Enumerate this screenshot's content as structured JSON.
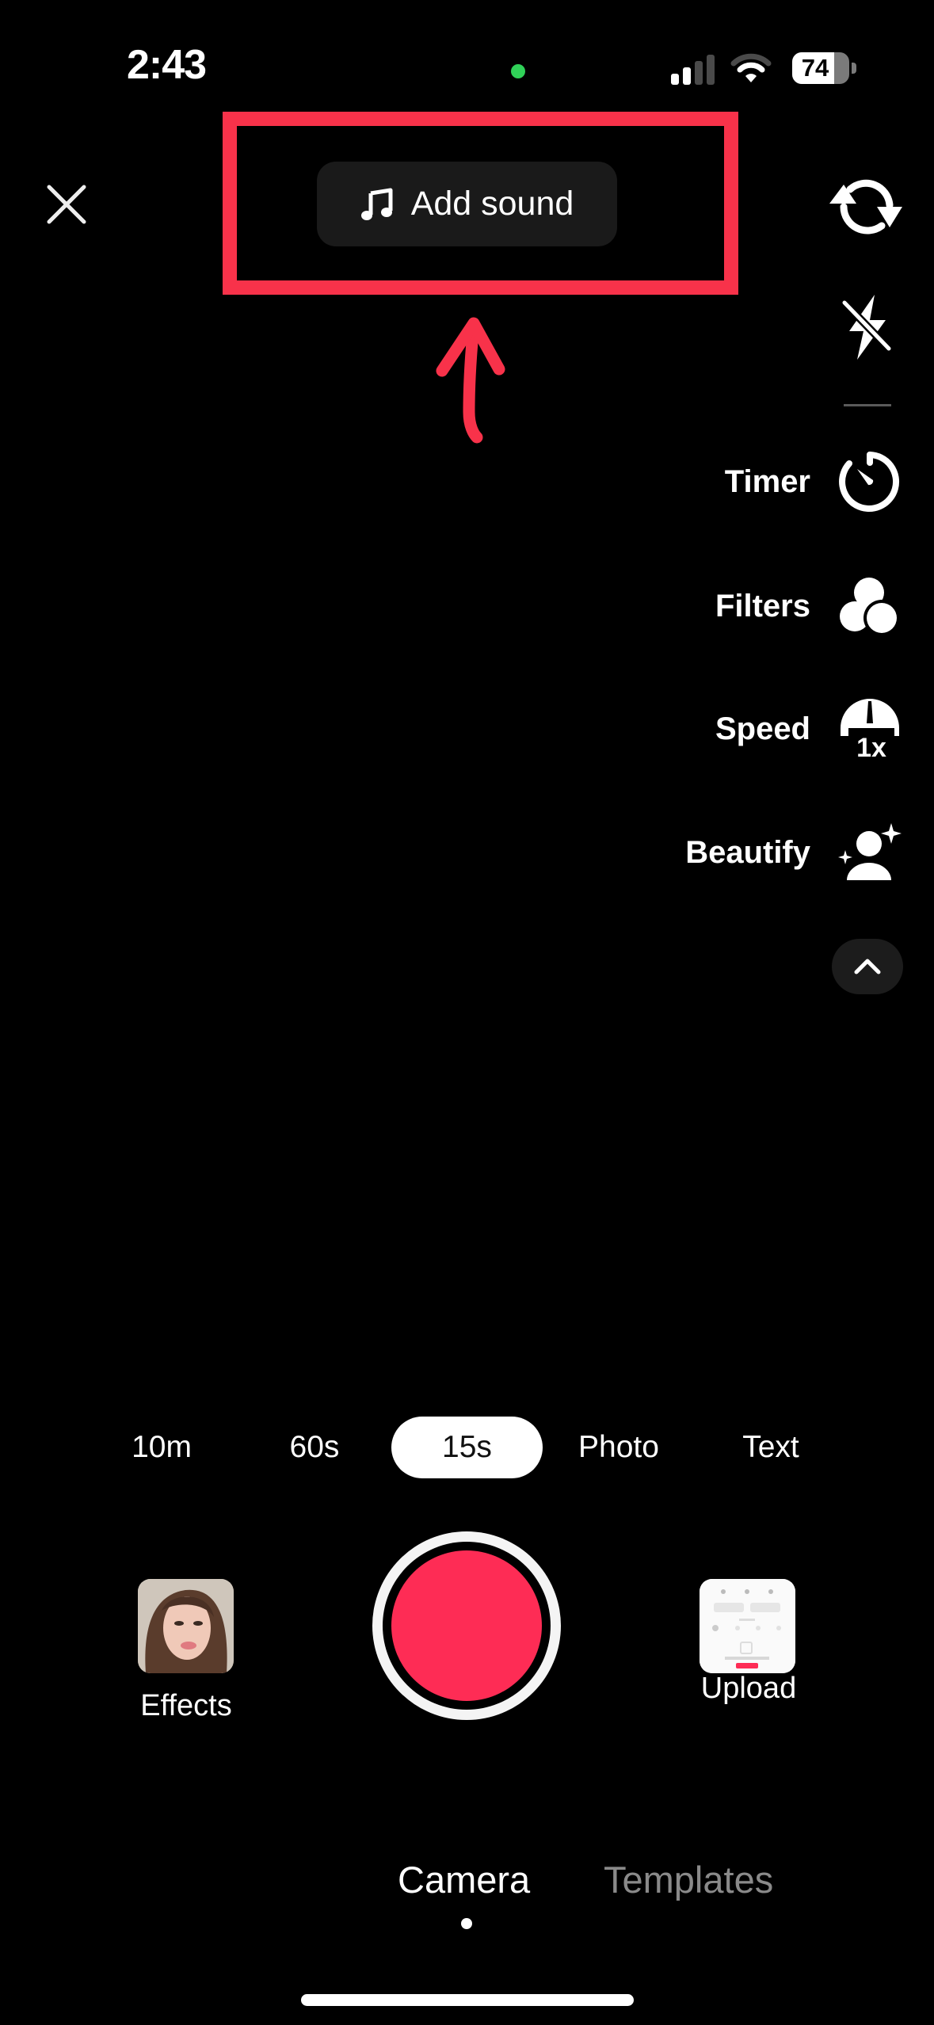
{
  "status_bar": {
    "time": "2:43",
    "privacy_indicator_color": "#30d158",
    "signal_bars_active": 2,
    "signal_bars_total": 4,
    "wifi_arcs_active": 2,
    "wifi_arcs_total": 3,
    "battery_percent": 74,
    "battery_label": "74"
  },
  "top": {
    "close_icon": "close-icon",
    "add_sound_label": "Add sound",
    "add_sound_icon": "music-note-icon",
    "flip_icon": "flip-camera-icon",
    "flash_icon": "flash-off-icon"
  },
  "annotation": {
    "color": "#f8324a",
    "shape": "rectangle-with-arrow"
  },
  "side_tools": [
    {
      "label": "Timer",
      "icon": "timer-icon"
    },
    {
      "label": "Filters",
      "icon": "filters-icon"
    },
    {
      "label": "Speed",
      "icon": "speed-icon",
      "badge": "1x"
    },
    {
      "label": "Beautify",
      "icon": "beautify-icon"
    }
  ],
  "collapse_icon": "chevron-up-icon",
  "modes": {
    "items": [
      "10m",
      "60s",
      "15s",
      "Photo",
      "Text"
    ],
    "selected": "15s"
  },
  "bottom": {
    "effects_label": "Effects",
    "upload_label": "Upload",
    "record_color": "#fe2c55"
  },
  "tabs": {
    "items": [
      {
        "label": "Camera",
        "active": true
      },
      {
        "label": "Templates",
        "active": false
      }
    ]
  },
  "colors": {
    "accent": "#fe2c55",
    "inactive_tab": "#8a8a8a",
    "pill_bg": "#1a1a1a"
  }
}
